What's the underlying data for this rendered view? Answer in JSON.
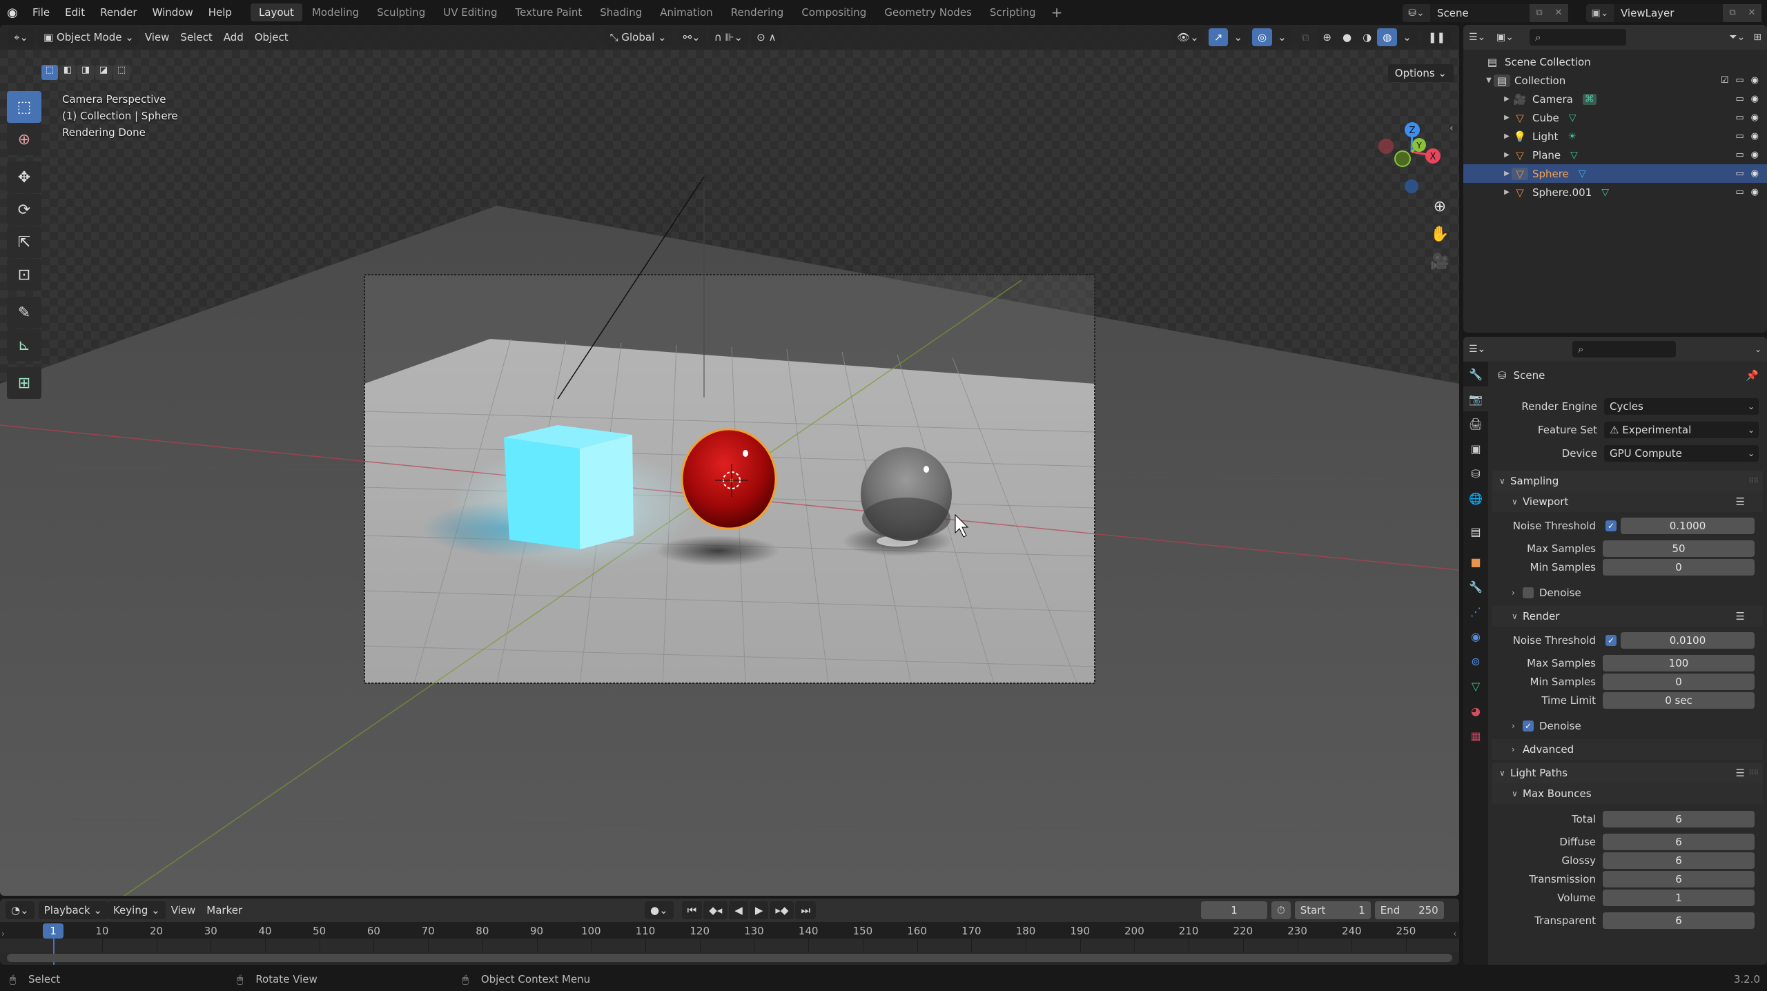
{
  "topbar": {
    "menus": [
      "File",
      "Edit",
      "Render",
      "Window",
      "Help"
    ],
    "workspaces": [
      "Layout",
      "Modeling",
      "Sculpting",
      "UV Editing",
      "Texture Paint",
      "Shading",
      "Animation",
      "Rendering",
      "Compositing",
      "Geometry Nodes",
      "Scripting"
    ],
    "active_workspace": "Layout",
    "add_workspace": "+",
    "scene": "Scene",
    "view_layer": "ViewLayer"
  },
  "viewport": {
    "mode": "Object Mode",
    "menus": [
      "View",
      "Select",
      "Add",
      "Object"
    ],
    "transform_orientation": "Global",
    "options_label": "Options",
    "overlay_lines": [
      "Camera Perspective",
      "(1) Collection | Sphere",
      "Rendering Done"
    ],
    "gizmo_axes": {
      "x": "X",
      "y": "Y",
      "z": "Z"
    },
    "colors": {
      "x_axis": "#e8465a",
      "y_axis": "#8ac33a",
      "z_axis": "#3d8eee",
      "selected_outline": "#f0a030"
    }
  },
  "outliner": {
    "search_placeholder": "",
    "root": "Scene Collection",
    "collection": "Collection",
    "items": [
      {
        "name": "Camera",
        "type": "camera",
        "selected": false
      },
      {
        "name": "Cube",
        "type": "mesh",
        "selected": false
      },
      {
        "name": "Light",
        "type": "light",
        "selected": false
      },
      {
        "name": "Plane",
        "type": "mesh",
        "selected": false
      },
      {
        "name": "Sphere",
        "type": "mesh",
        "selected": true
      },
      {
        "name": "Sphere.001",
        "type": "mesh",
        "selected": false
      }
    ]
  },
  "properties": {
    "context": "Scene",
    "render_engine_label": "Render Engine",
    "render_engine": "Cycles",
    "feature_set_label": "Feature Set",
    "feature_set": "Experimental",
    "device_label": "Device",
    "device": "GPU Compute",
    "sampling": {
      "title": "Sampling",
      "viewport": {
        "title": "Viewport",
        "noise_threshold_label": "Noise Threshold",
        "noise_threshold_enabled": true,
        "noise_threshold": "0.1000",
        "max_samples_label": "Max Samples",
        "max_samples": "50",
        "min_samples_label": "Min Samples",
        "min_samples": "0",
        "denoise_label": "Denoise",
        "denoise": false
      },
      "render": {
        "title": "Render",
        "noise_threshold_label": "Noise Threshold",
        "noise_threshold_enabled": true,
        "noise_threshold": "0.0100",
        "max_samples_label": "Max Samples",
        "max_samples": "100",
        "min_samples_label": "Min Samples",
        "min_samples": "0",
        "time_limit_label": "Time Limit",
        "time_limit": "0 sec",
        "denoise_label": "Denoise",
        "denoise": true
      },
      "advanced_label": "Advanced"
    },
    "light_paths": {
      "title": "Light Paths",
      "max_bounces_title": "Max Bounces",
      "rows": [
        {
          "label": "Total",
          "value": "6"
        },
        {
          "label": "Diffuse",
          "value": "6"
        },
        {
          "label": "Glossy",
          "value": "6"
        },
        {
          "label": "Transmission",
          "value": "6"
        },
        {
          "label": "Volume",
          "value": "1"
        },
        {
          "label": "Transparent",
          "value": "6"
        }
      ]
    }
  },
  "timeline": {
    "menus": [
      "Playback",
      "Keying",
      "View",
      "Marker"
    ],
    "current_frame": "1",
    "start_label": "Start",
    "start": "1",
    "end_label": "End",
    "end": "250",
    "ticks": [
      10,
      20,
      30,
      40,
      50,
      60,
      70,
      80,
      90,
      100,
      110,
      120,
      130,
      140,
      150,
      160,
      170,
      180,
      190,
      200,
      210,
      220,
      230,
      240,
      250
    ]
  },
  "statusbar": {
    "hints": [
      "Select",
      "Rotate View",
      "Object Context Menu"
    ],
    "version": "3.2.0"
  }
}
